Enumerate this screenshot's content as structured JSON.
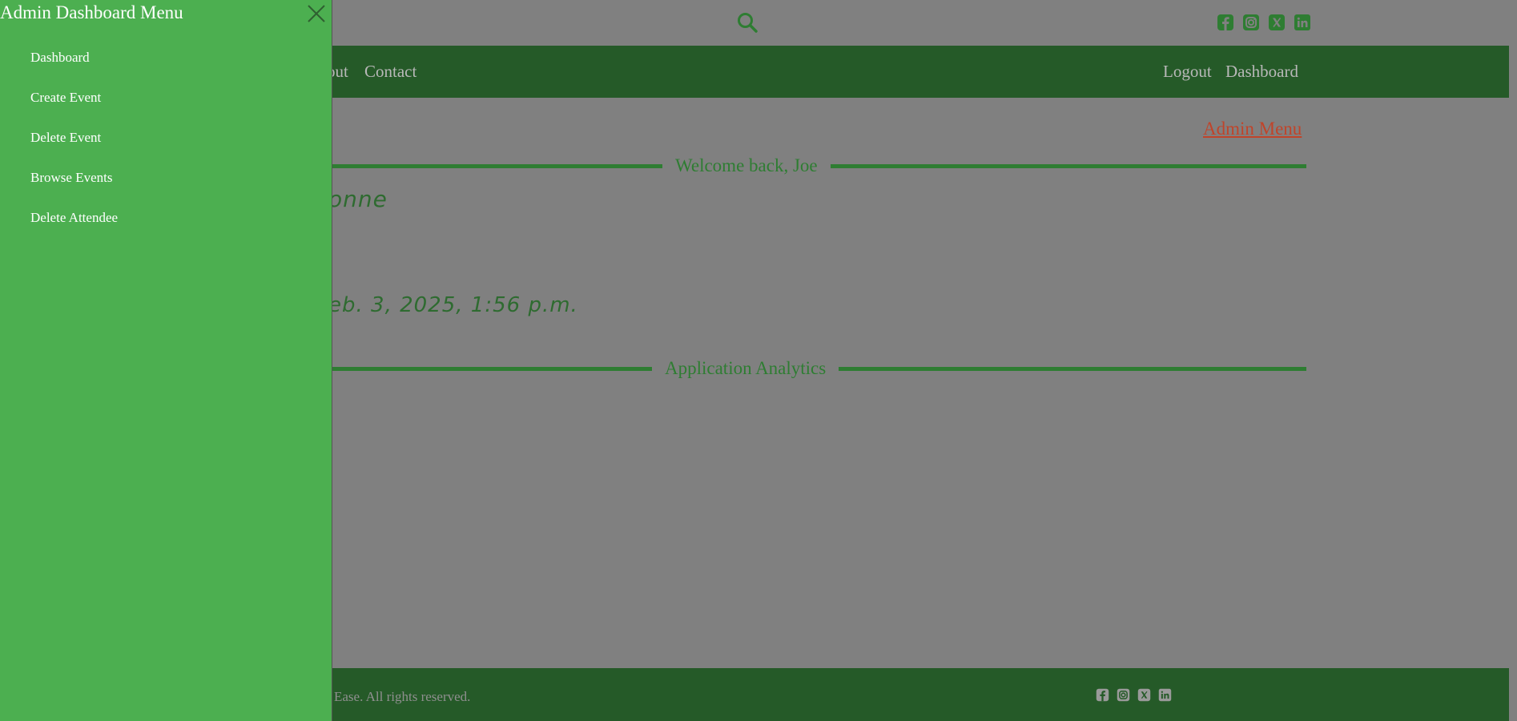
{
  "topbar": {
    "search_icon": "search-icon",
    "social_icons": [
      "facebook-icon",
      "instagram-icon",
      "x-icon",
      "linkedin-icon"
    ],
    "icon_color": "#2e7d32"
  },
  "nav": {
    "left_links": [
      {
        "label": "out"
      },
      {
        "label": "Contact"
      }
    ],
    "right_links": [
      {
        "label": "Logout"
      },
      {
        "label": "Dashboard"
      }
    ],
    "background": "#255a28"
  },
  "main": {
    "admin_menu_link": "Admin Menu",
    "welcome_heading": "Welcome back, Joe",
    "name_fragment": "onne",
    "date_fragment": "eb. 3, 2025, 1:56 p.m.",
    "analytics_heading": "Application Analytics"
  },
  "footer": {
    "text": "t Ease. All rights reserved.",
    "social_icons": [
      "facebook-icon",
      "instagram-icon",
      "x-icon",
      "linkedin-icon"
    ]
  },
  "drawer": {
    "title": "Admin Dashboard Menu",
    "close_icon": "close-icon",
    "items": [
      {
        "label": "Dashboard"
      },
      {
        "label": "Create Event"
      },
      {
        "label": "Delete Event"
      },
      {
        "label": "Browse Events"
      },
      {
        "label": "Delete Attendee"
      }
    ],
    "background": "#4caf50"
  }
}
